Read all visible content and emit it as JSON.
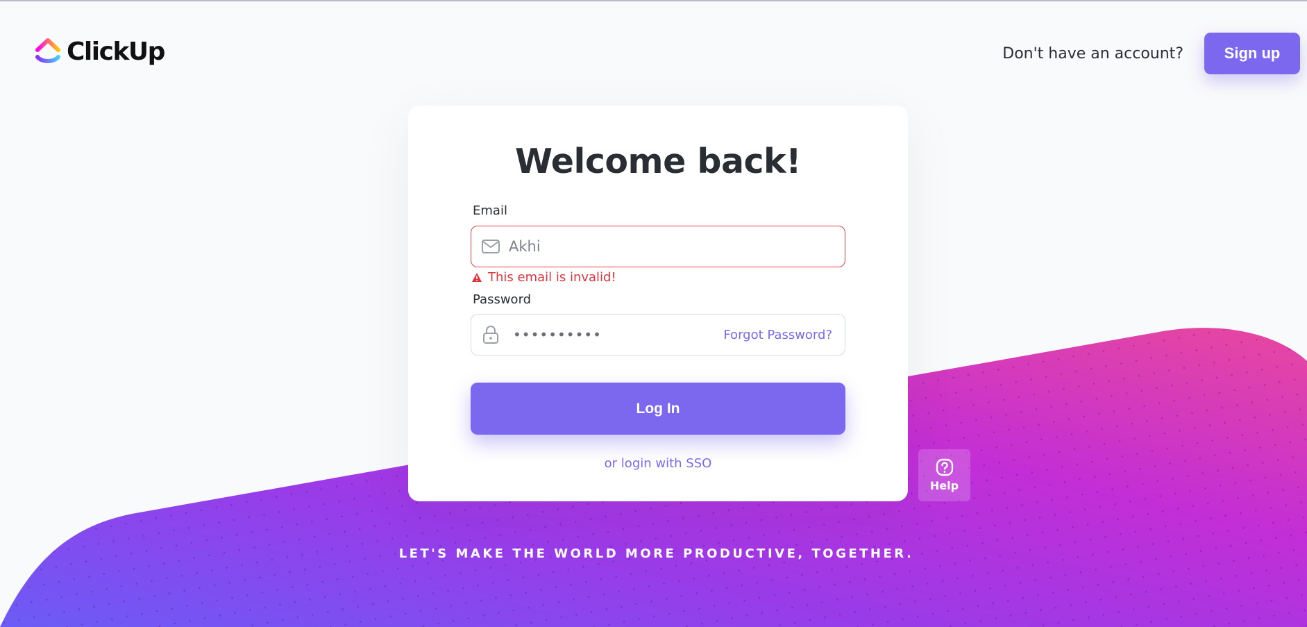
{
  "brand": {
    "name": "ClickUp"
  },
  "header": {
    "no_account_text": "Don't have an account?",
    "signup_label": "Sign up"
  },
  "login": {
    "title": "Welcome back!",
    "email_label": "Email",
    "email_value": "Akhi",
    "email_error": "This email is invalid!",
    "password_label": "Password",
    "password_value": "••••••••••",
    "forgot_label": "Forgot Password?",
    "login_label": "Log In",
    "sso_label": "or login with SSO"
  },
  "help": {
    "label": "Help"
  },
  "footer": {
    "tagline": "LET'S MAKE THE WORLD MORE PRODUCTIVE, TOGETHER."
  },
  "colors": {
    "accent": "#7b68ee",
    "error": "#d9363e",
    "gradient_start": "#7b5cf5",
    "gradient_mid": "#c03ad8",
    "gradient_end": "#e84aa6"
  },
  "icons": {
    "logo": "clickup-logo-icon",
    "email": "envelope-icon",
    "password": "lock-icon",
    "error": "warning-icon",
    "help": "question-circle-icon"
  }
}
